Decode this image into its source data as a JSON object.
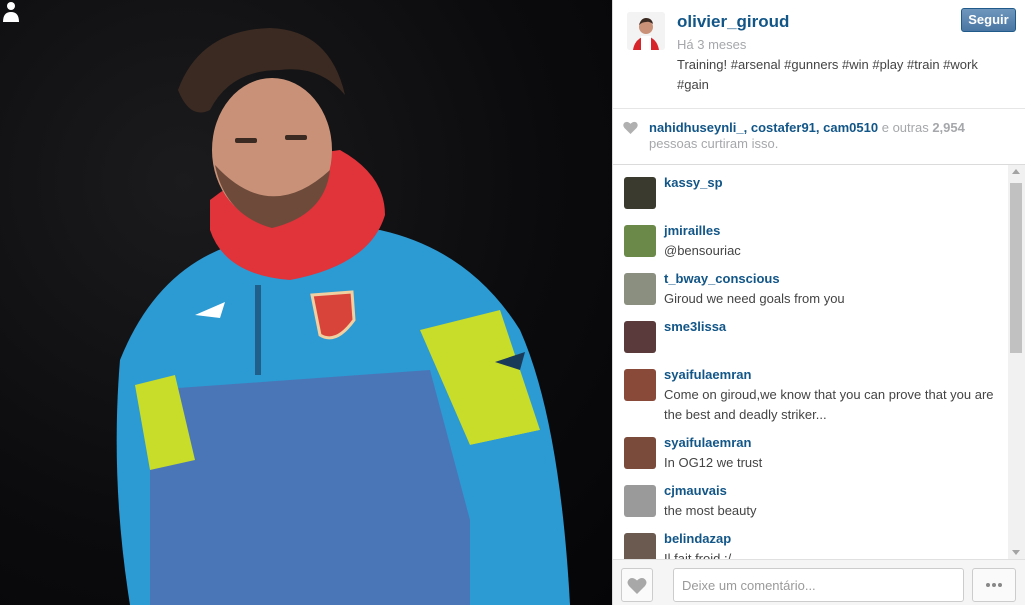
{
  "post": {
    "username": "olivier_giroud",
    "time": "Há 3 meses",
    "caption": "Training! #arsenal #gunners #win #play #train #work #gain",
    "follow_label": "Seguir"
  },
  "likes": {
    "users": [
      "nahidhuseynli_",
      "costafer91",
      "cam0510"
    ],
    "sep1": ", ",
    "sep2": ", ",
    "others_prefix": " e outras ",
    "count": "2,954",
    "suffix": "pessoas curtiram isso."
  },
  "comments": [
    {
      "user": "kassy_sp",
      "text": "",
      "avatar_color": "#3a3a2e"
    },
    {
      "user": "jmirailles",
      "text": "@bensouriac",
      "avatar_color": "#6b8a4a"
    },
    {
      "user": "t_bway_conscious",
      "text": "Giroud we need goals from you",
      "avatar_color": "#8a8f80"
    },
    {
      "user": "sme3lissa",
      "text": "",
      "avatar_color": "#5a3a3a"
    },
    {
      "user": "syaifulaemran",
      "text": "Come on giroud,we know that you can prove that you are the best and deadly striker...",
      "avatar_color": "#8a4a3a"
    },
    {
      "user": "syaifulaemran",
      "text": "In OG12 we trust",
      "avatar_color": "#7a4a3a"
    },
    {
      "user": "cjmauvais",
      "text": "the most beauty",
      "avatar_color": "#9a9a9a"
    },
    {
      "user": "belindazap",
      "text": "Il fait froid :/",
      "avatar_color": "#6a5a50"
    }
  ],
  "footer": {
    "comment_placeholder": "Deixe um comentário..."
  },
  "colors": {
    "link": "#125688",
    "muted": "#a5a7aa",
    "follow_button": "#4a76a3"
  },
  "icons": [
    "person-icon",
    "heart-icon",
    "more-icon",
    "scroll-up-icon",
    "scroll-down-icon"
  ]
}
